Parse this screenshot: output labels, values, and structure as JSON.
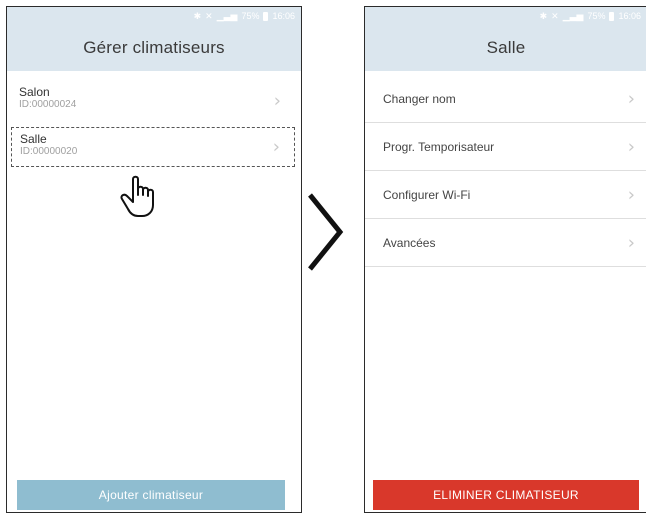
{
  "left_screen": {
    "status": {
      "percent": "75%",
      "time": "16:06"
    },
    "title": "Gérer climatiseurs",
    "devices": [
      {
        "name": "Salon",
        "id": "ID:00000024"
      },
      {
        "name": "Salle",
        "id": "ID:00000020"
      }
    ],
    "add_button": "Ajouter climatiseur"
  },
  "right_screen": {
    "status": {
      "percent": "75%",
      "time": "16:06"
    },
    "title": "Salle",
    "menu": [
      {
        "label": "Changer nom"
      },
      {
        "label": "Progr. Temporisateur"
      },
      {
        "label": "Configurer Wi-Fi"
      },
      {
        "label": "Avancées"
      }
    ],
    "delete_button": "ELIMINER CLIMATISEUR"
  },
  "icons": {
    "chevron": "chevron-right-icon",
    "pointer": "hand-pointer-icon",
    "transition": "arrow-right-icon"
  },
  "colors": {
    "header_bg": "#dbe6ee",
    "add_button_bg": "#8fbdd0",
    "delete_button_bg": "#d9382b"
  }
}
